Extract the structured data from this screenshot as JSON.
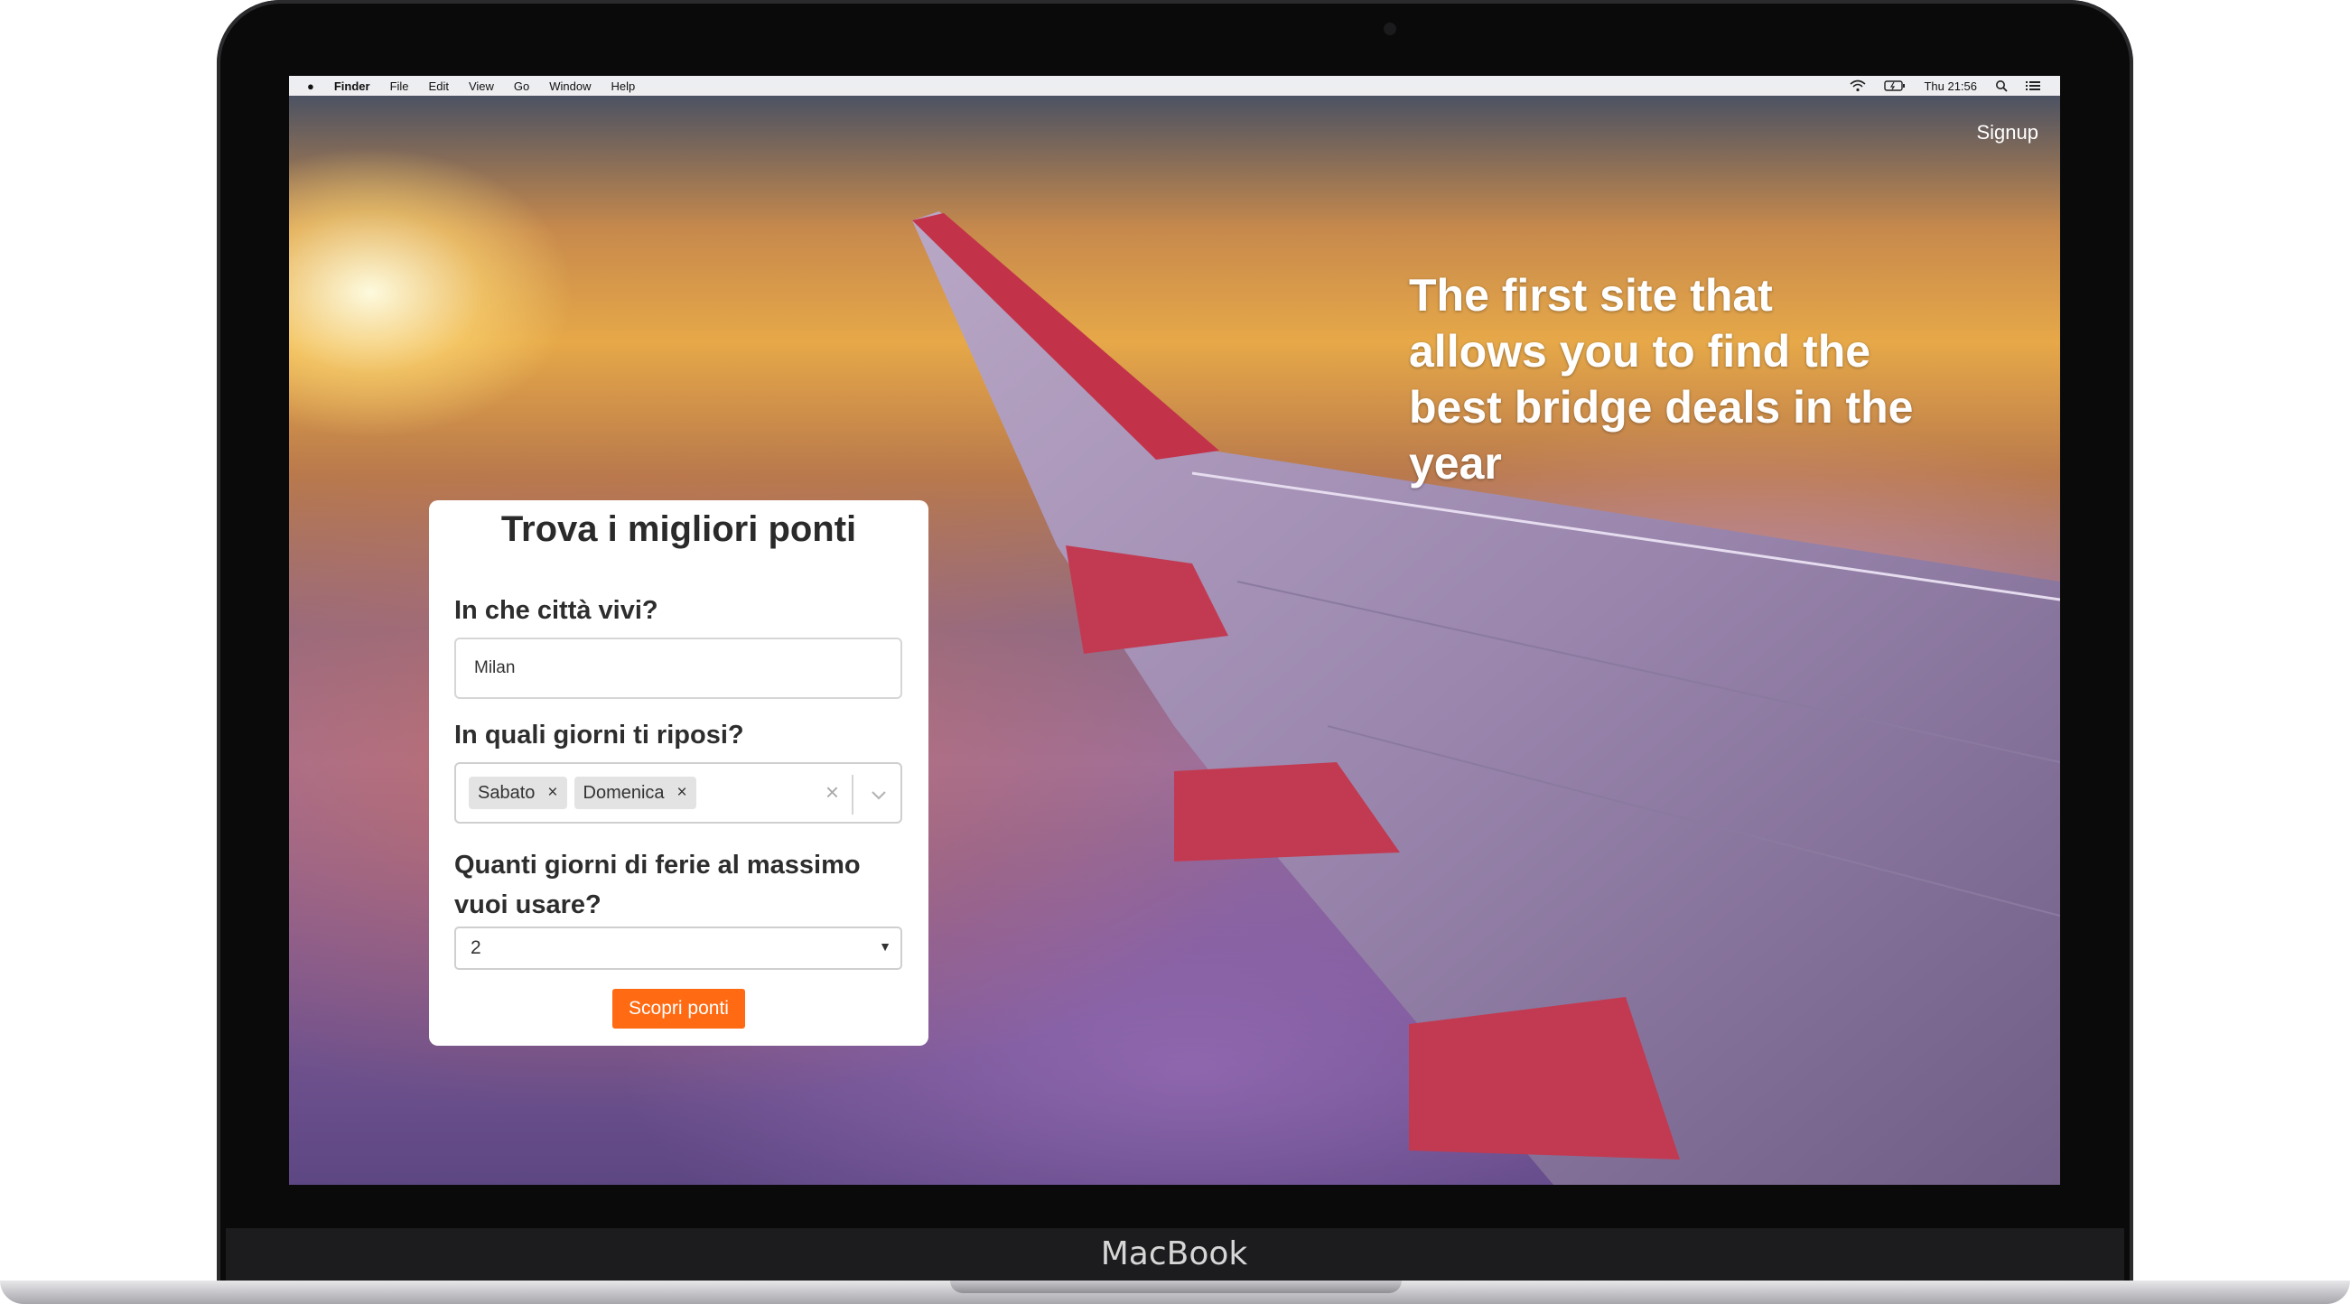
{
  "menubar": {
    "app": "Finder",
    "items": [
      "File",
      "Edit",
      "View",
      "Go",
      "Window",
      "Help"
    ],
    "clock": "Thu 21:56",
    "icons": [
      "apple-icon",
      "wifi-icon",
      "battery-icon",
      "spotlight-icon",
      "notification-center-icon"
    ]
  },
  "header": {
    "signup": "Signup"
  },
  "hero": {
    "tagline": "The first site that allows you to find the best bridge deals in the year"
  },
  "form": {
    "title": "Trova i migliori ponti",
    "city_label": "In che città vivi?",
    "city_value": "Milan",
    "days_label": "In quali giorni ti riposi?",
    "days_selected": [
      "Sabato",
      "Domenica"
    ],
    "holidays_label": "Quanti giorni di ferie al massimo vuoi usare?",
    "holidays_value": "2",
    "submit": "Scopri ponti",
    "accent_color": "#ff6a13"
  },
  "device": {
    "label": "MacBook"
  }
}
